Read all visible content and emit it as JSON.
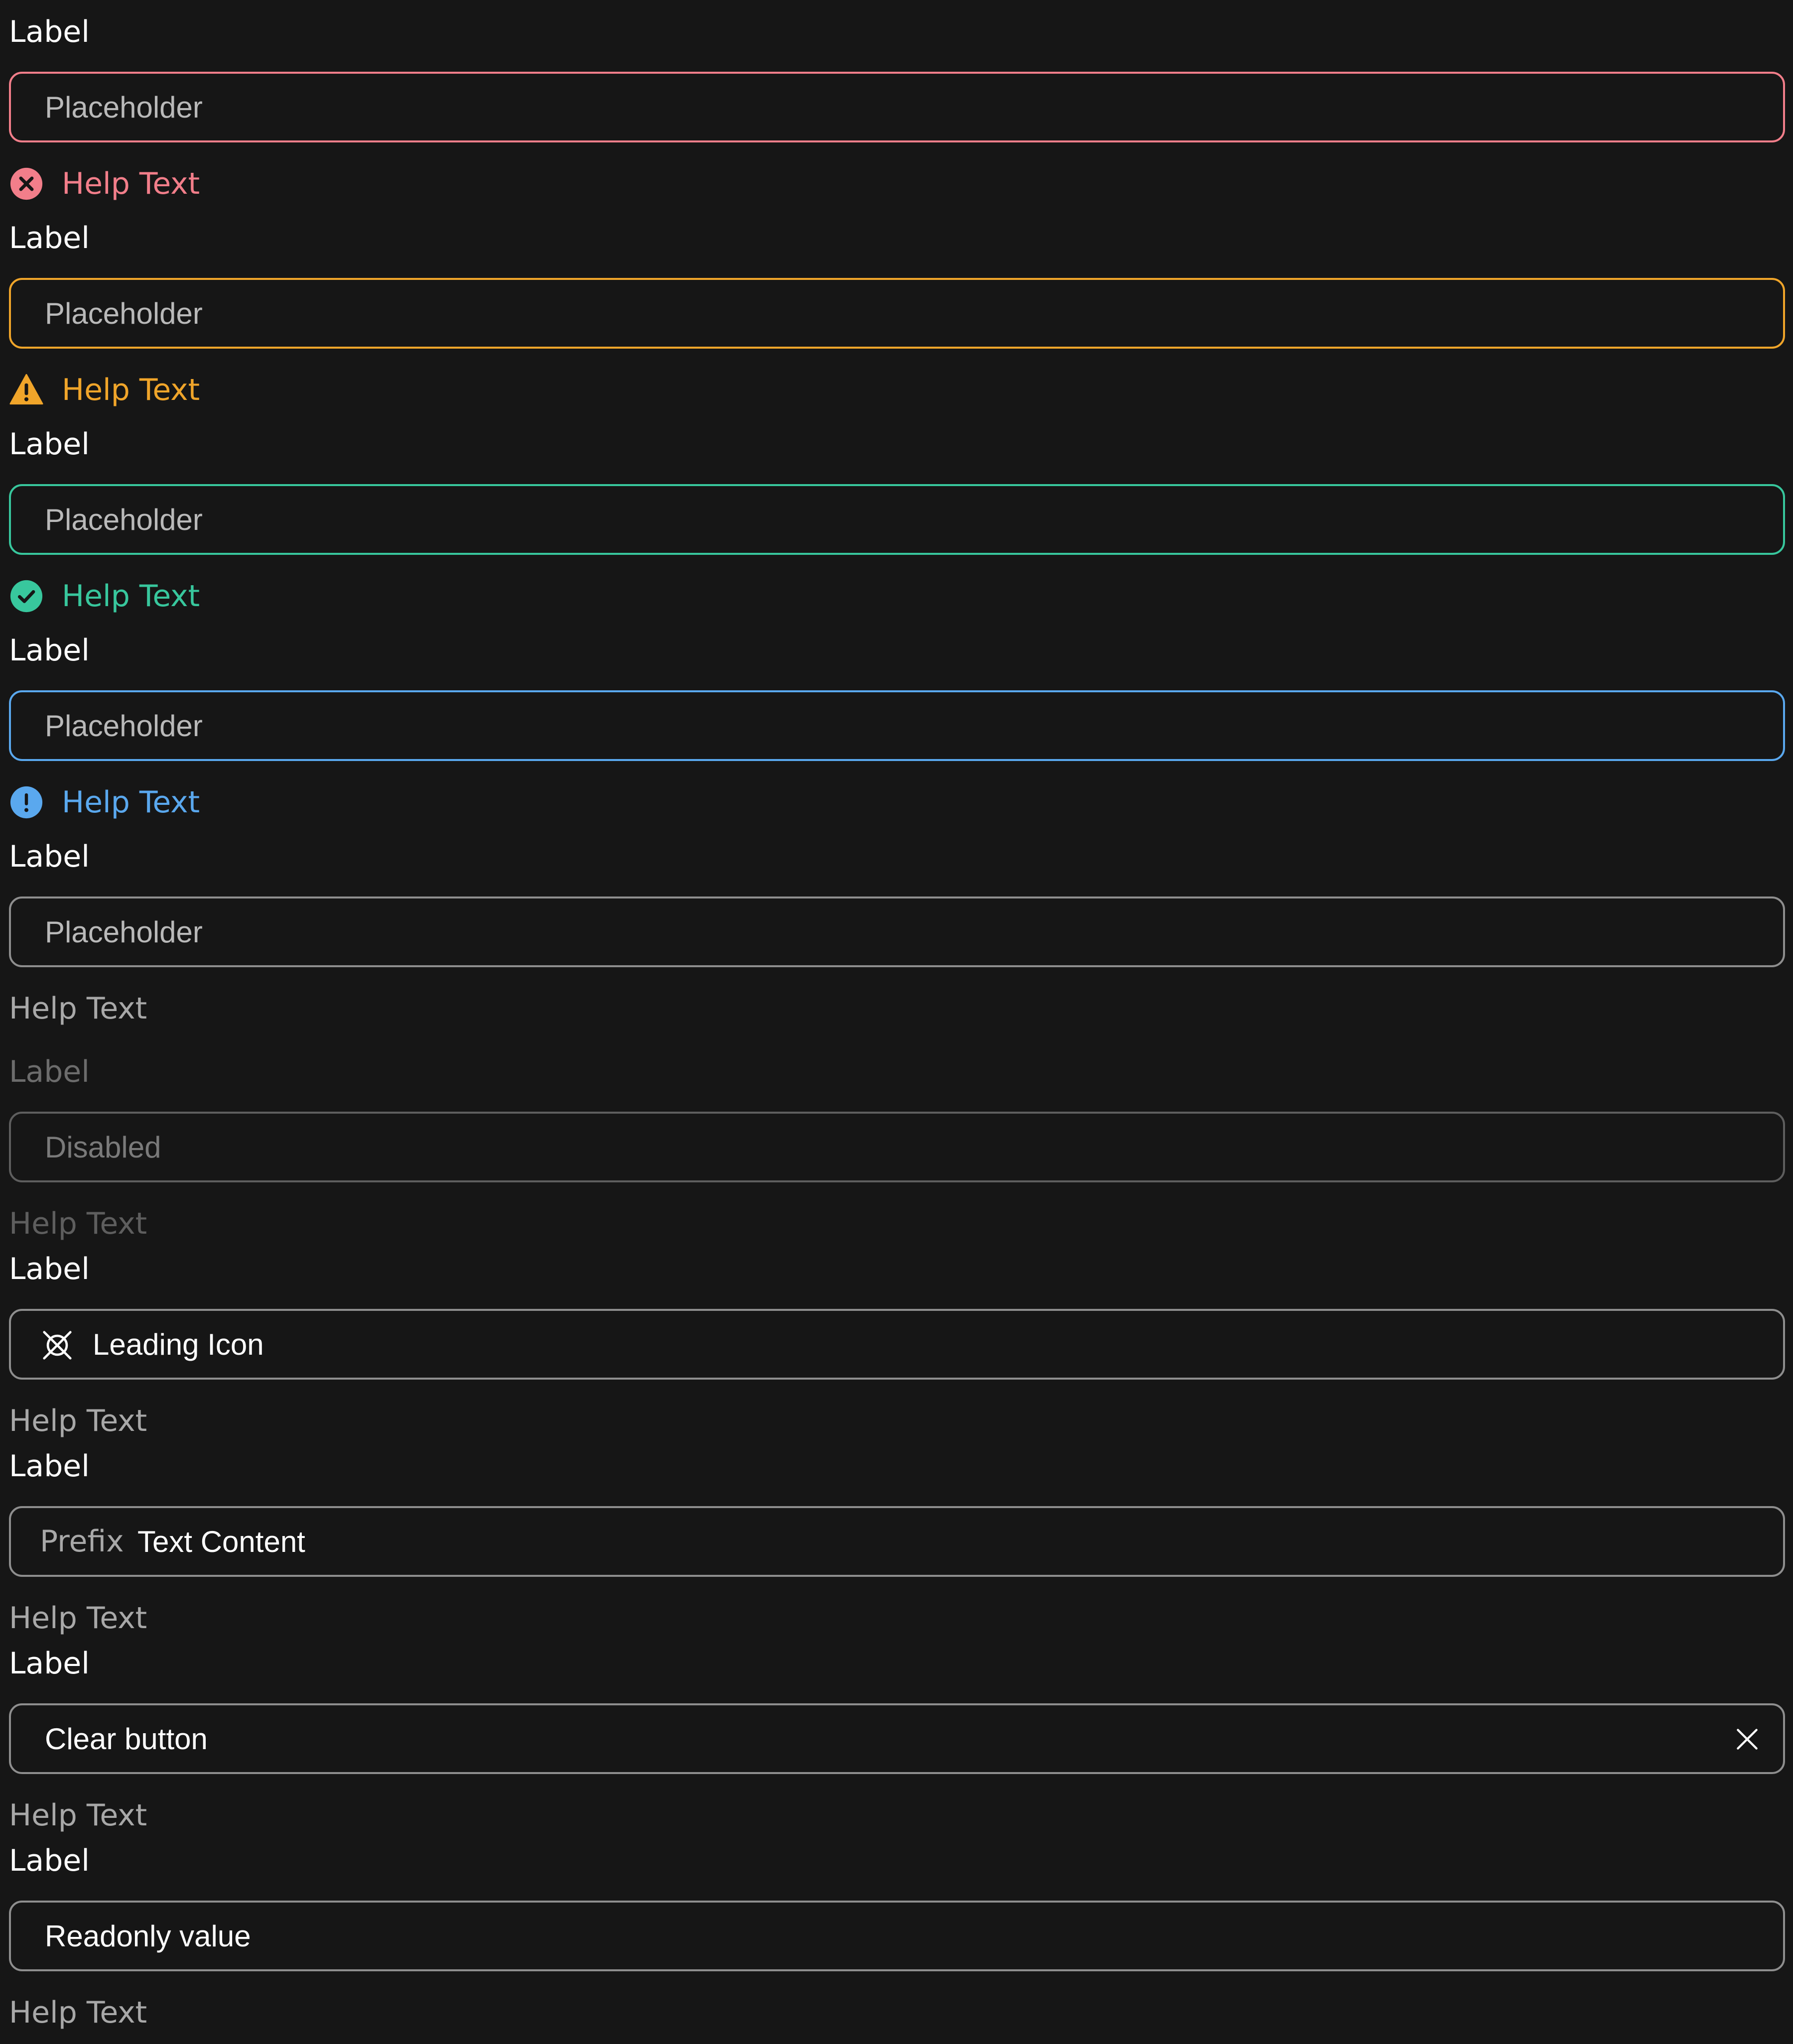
{
  "colors": {
    "background": "#161616",
    "error": "#f27e8a",
    "warning": "#f0a52a",
    "success": "#38c79d",
    "info": "#5aa8ee",
    "neutral_border": "#8e8e8e",
    "disabled": "#5e5e5e"
  },
  "fields": [
    {
      "state": "error",
      "label": "Label",
      "placeholder": "Placeholder",
      "help": "Help Text",
      "help_icon": "error-circle-icon"
    },
    {
      "state": "warning",
      "label": "Label",
      "placeholder": "Placeholder",
      "help": "Help Text",
      "help_icon": "warning-triangle-icon"
    },
    {
      "state": "success",
      "label": "Label",
      "placeholder": "Placeholder",
      "help": "Help Text",
      "help_icon": "check-circle-icon"
    },
    {
      "state": "info",
      "label": "Label",
      "placeholder": "Placeholder",
      "help": "Help Text",
      "help_icon": "info-circle-icon"
    },
    {
      "state": "default",
      "label": "Label",
      "placeholder": "Placeholder",
      "help": "Help Text"
    },
    {
      "state": "disabled",
      "label": "Label",
      "placeholder": "Disabled",
      "help": "Help Text"
    },
    {
      "state": "leading-icon",
      "label": "Label",
      "value": "Leading Icon",
      "help": "Help Text",
      "leading_icon": "placeholder-cross-icon"
    },
    {
      "state": "prefix",
      "label": "Label",
      "prefix": "Prefix",
      "value": "Text Content",
      "help": "Help Text"
    },
    {
      "state": "clearable",
      "label": "Label",
      "value": "Clear button",
      "help": "Help Text",
      "trailing_icon": "close-icon"
    },
    {
      "state": "readonly",
      "label": "Label",
      "value": "Readonly value",
      "help": "Help Text"
    }
  ]
}
